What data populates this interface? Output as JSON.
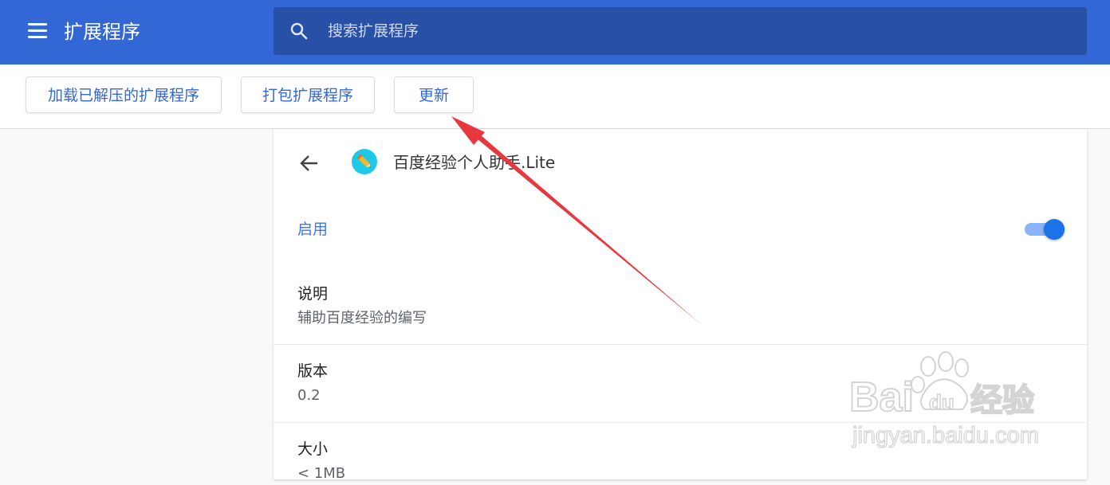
{
  "header": {
    "title": "扩展程序",
    "search_placeholder": "搜索扩展程序"
  },
  "toolbar": {
    "buttons": [
      "加载已解压的扩展程序",
      "打包扩展程序",
      "更新"
    ]
  },
  "extension": {
    "name": "百度经验个人助手.Lite",
    "enabled_label": "启用",
    "enabled": true,
    "fields": [
      {
        "title": "说明",
        "value": "辅助百度经验的编写"
      },
      {
        "title": "版本",
        "value": "0.2"
      },
      {
        "title": "大小",
        "value": "< 1MB"
      }
    ]
  },
  "watermark": {
    "brand": "Bai",
    "brand2": "du",
    "brand_cn": "经验",
    "url": "jingyan.baidu.com"
  },
  "colors": {
    "header_bg": "#3367d6",
    "search_bg": "#2850a6",
    "accent": "#3367d6",
    "toggle_on": "#1a73e8",
    "arrow": "#e8383d"
  },
  "icons": [
    "menu-icon",
    "search-icon",
    "back-arrow-icon",
    "extension-icon"
  ]
}
